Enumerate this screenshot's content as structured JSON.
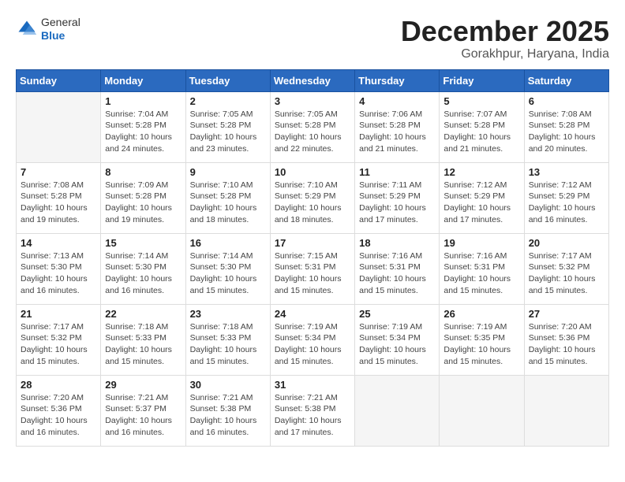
{
  "header": {
    "logo_line1": "General",
    "logo_line2": "Blue",
    "month_year": "December 2025",
    "location": "Gorakhpur, Haryana, India"
  },
  "weekdays": [
    "Sunday",
    "Monday",
    "Tuesday",
    "Wednesday",
    "Thursday",
    "Friday",
    "Saturday"
  ],
  "weeks": [
    [
      {
        "day": "",
        "empty": true
      },
      {
        "day": "1",
        "sunrise": "7:04 AM",
        "sunset": "5:28 PM",
        "daylight": "10 hours and 24 minutes."
      },
      {
        "day": "2",
        "sunrise": "7:05 AM",
        "sunset": "5:28 PM",
        "daylight": "10 hours and 23 minutes."
      },
      {
        "day": "3",
        "sunrise": "7:05 AM",
        "sunset": "5:28 PM",
        "daylight": "10 hours and 22 minutes."
      },
      {
        "day": "4",
        "sunrise": "7:06 AM",
        "sunset": "5:28 PM",
        "daylight": "10 hours and 21 minutes."
      },
      {
        "day": "5",
        "sunrise": "7:07 AM",
        "sunset": "5:28 PM",
        "daylight": "10 hours and 21 minutes."
      },
      {
        "day": "6",
        "sunrise": "7:08 AM",
        "sunset": "5:28 PM",
        "daylight": "10 hours and 20 minutes."
      }
    ],
    [
      {
        "day": "7",
        "sunrise": "7:08 AM",
        "sunset": "5:28 PM",
        "daylight": "10 hours and 19 minutes."
      },
      {
        "day": "8",
        "sunrise": "7:09 AM",
        "sunset": "5:28 PM",
        "daylight": "10 hours and 19 minutes."
      },
      {
        "day": "9",
        "sunrise": "7:10 AM",
        "sunset": "5:28 PM",
        "daylight": "10 hours and 18 minutes."
      },
      {
        "day": "10",
        "sunrise": "7:10 AM",
        "sunset": "5:29 PM",
        "daylight": "10 hours and 18 minutes."
      },
      {
        "day": "11",
        "sunrise": "7:11 AM",
        "sunset": "5:29 PM",
        "daylight": "10 hours and 17 minutes."
      },
      {
        "day": "12",
        "sunrise": "7:12 AM",
        "sunset": "5:29 PM",
        "daylight": "10 hours and 17 minutes."
      },
      {
        "day": "13",
        "sunrise": "7:12 AM",
        "sunset": "5:29 PM",
        "daylight": "10 hours and 16 minutes."
      }
    ],
    [
      {
        "day": "14",
        "sunrise": "7:13 AM",
        "sunset": "5:30 PM",
        "daylight": "10 hours and 16 minutes."
      },
      {
        "day": "15",
        "sunrise": "7:14 AM",
        "sunset": "5:30 PM",
        "daylight": "10 hours and 16 minutes."
      },
      {
        "day": "16",
        "sunrise": "7:14 AM",
        "sunset": "5:30 PM",
        "daylight": "10 hours and 15 minutes."
      },
      {
        "day": "17",
        "sunrise": "7:15 AM",
        "sunset": "5:31 PM",
        "daylight": "10 hours and 15 minutes."
      },
      {
        "day": "18",
        "sunrise": "7:16 AM",
        "sunset": "5:31 PM",
        "daylight": "10 hours and 15 minutes."
      },
      {
        "day": "19",
        "sunrise": "7:16 AM",
        "sunset": "5:31 PM",
        "daylight": "10 hours and 15 minutes."
      },
      {
        "day": "20",
        "sunrise": "7:17 AM",
        "sunset": "5:32 PM",
        "daylight": "10 hours and 15 minutes."
      }
    ],
    [
      {
        "day": "21",
        "sunrise": "7:17 AM",
        "sunset": "5:32 PM",
        "daylight": "10 hours and 15 minutes."
      },
      {
        "day": "22",
        "sunrise": "7:18 AM",
        "sunset": "5:33 PM",
        "daylight": "10 hours and 15 minutes."
      },
      {
        "day": "23",
        "sunrise": "7:18 AM",
        "sunset": "5:33 PM",
        "daylight": "10 hours and 15 minutes."
      },
      {
        "day": "24",
        "sunrise": "7:19 AM",
        "sunset": "5:34 PM",
        "daylight": "10 hours and 15 minutes."
      },
      {
        "day": "25",
        "sunrise": "7:19 AM",
        "sunset": "5:34 PM",
        "daylight": "10 hours and 15 minutes."
      },
      {
        "day": "26",
        "sunrise": "7:19 AM",
        "sunset": "5:35 PM",
        "daylight": "10 hours and 15 minutes."
      },
      {
        "day": "27",
        "sunrise": "7:20 AM",
        "sunset": "5:36 PM",
        "daylight": "10 hours and 15 minutes."
      }
    ],
    [
      {
        "day": "28",
        "sunrise": "7:20 AM",
        "sunset": "5:36 PM",
        "daylight": "10 hours and 16 minutes."
      },
      {
        "day": "29",
        "sunrise": "7:21 AM",
        "sunset": "5:37 PM",
        "daylight": "10 hours and 16 minutes."
      },
      {
        "day": "30",
        "sunrise": "7:21 AM",
        "sunset": "5:38 PM",
        "daylight": "10 hours and 16 minutes."
      },
      {
        "day": "31",
        "sunrise": "7:21 AM",
        "sunset": "5:38 PM",
        "daylight": "10 hours and 17 minutes."
      },
      {
        "day": "",
        "empty": true
      },
      {
        "day": "",
        "empty": true
      },
      {
        "day": "",
        "empty": true
      }
    ]
  ],
  "labels": {
    "sunrise": "Sunrise:",
    "sunset": "Sunset:",
    "daylight": "Daylight:"
  }
}
